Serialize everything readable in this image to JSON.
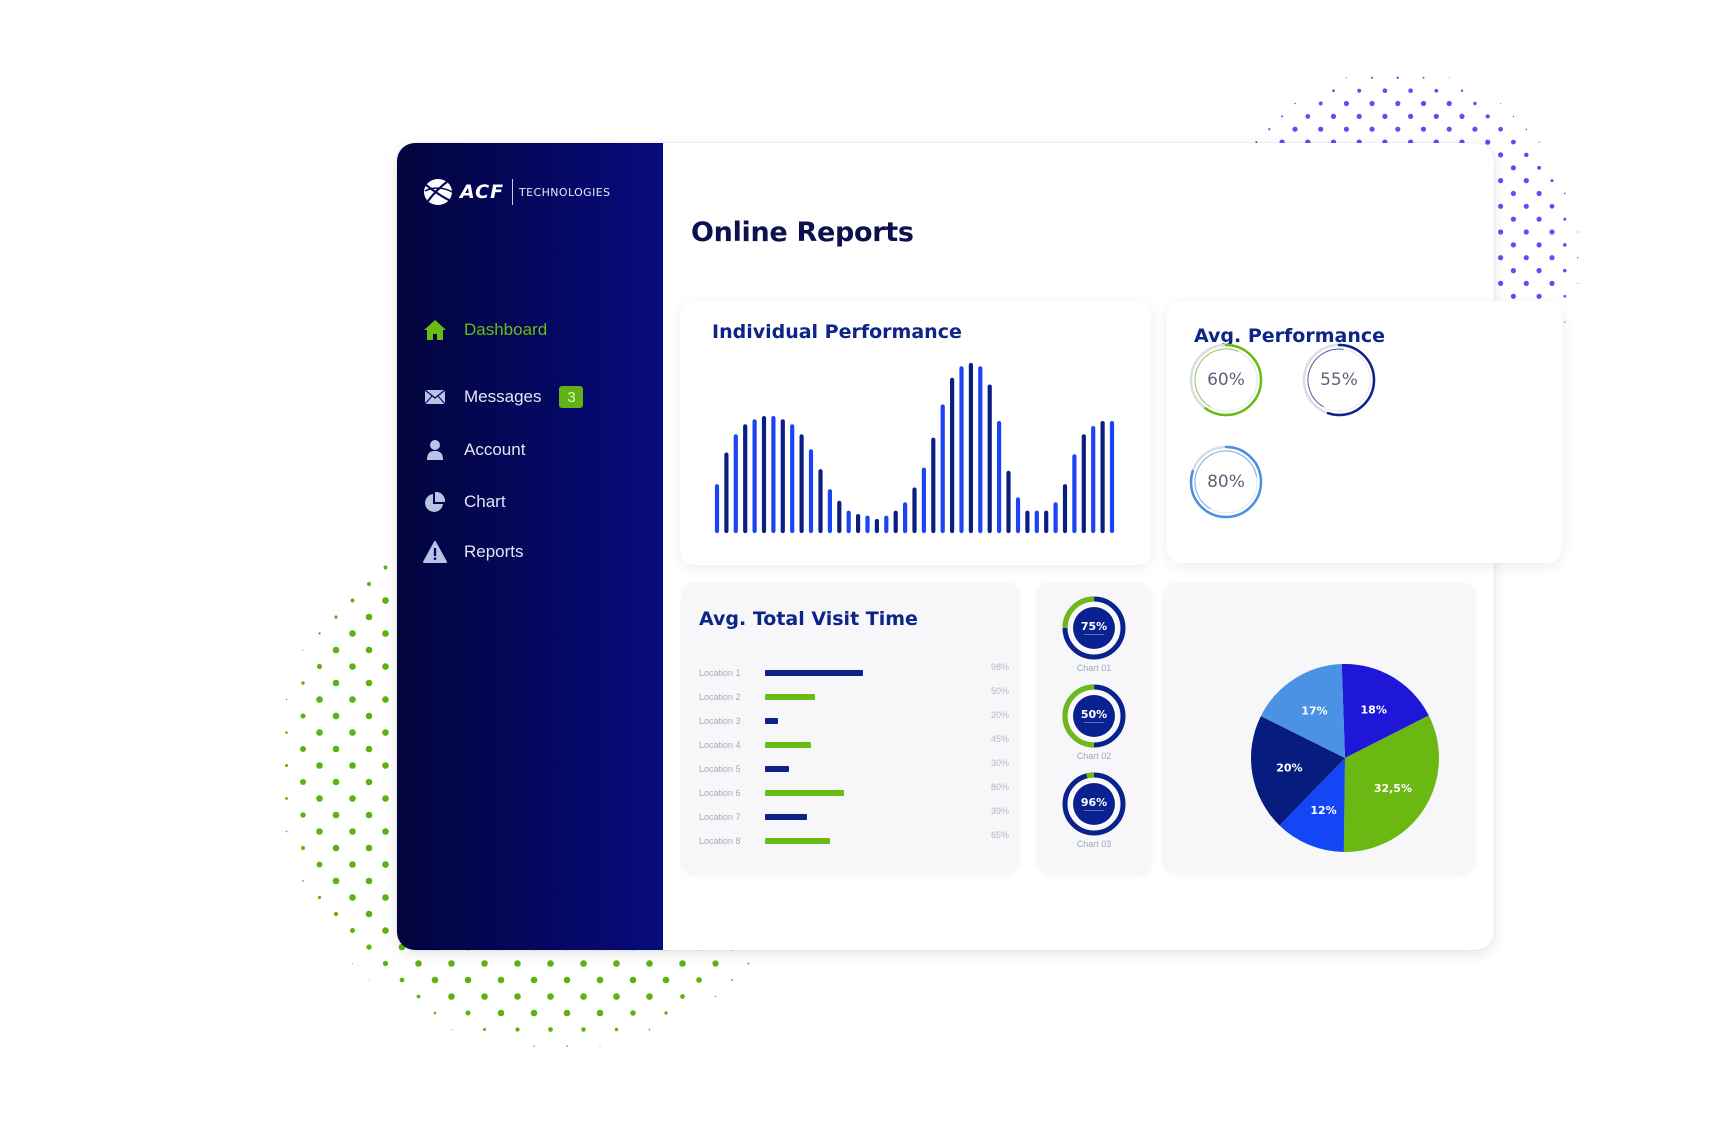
{
  "brand": {
    "name": "ACF",
    "suffix": "TECHNOLOGIES",
    "colors": {
      "navy": "#040760",
      "green": "#6cbb14",
      "blue": "#1a44f5",
      "dark_blue": "#0b1f80",
      "dots_blue": "#5a4ff5",
      "dots_green": "#5cb30e"
    }
  },
  "sidebar": {
    "items": [
      {
        "label": "Dashboard",
        "icon": "home-icon",
        "active": true
      },
      {
        "label": "Messages",
        "icon": "envelope-icon",
        "badge": "3"
      },
      {
        "label": "Account",
        "icon": "user-icon"
      },
      {
        "label": "Chart",
        "icon": "pie-chart-icon"
      },
      {
        "label": "Reports",
        "icon": "warning-icon"
      }
    ]
  },
  "page": {
    "title": "Online Reports"
  },
  "individual_performance": {
    "title": "Individual Performance"
  },
  "avg_performance": {
    "title": "Avg. Performance",
    "rings": [
      {
        "label": "60%",
        "value": 0.6,
        "color": "#6cbb14"
      },
      {
        "label": "55%",
        "value": 0.55,
        "color": "#0d2488"
      },
      {
        "label": "80%",
        "value": 0.8,
        "color": "#4a90e2"
      }
    ]
  },
  "visit_time": {
    "title": "Avg. Total Visit Time",
    "rows": [
      {
        "label": "Location 1",
        "value": "98%",
        "bar": 0.98,
        "color": "#0b2389"
      },
      {
        "label": "Location 2",
        "value": "50%",
        "bar": 0.5,
        "color": "#6cbb14"
      },
      {
        "label": "Location 3",
        "value": "20%",
        "bar": 0.13,
        "color": "#0b2389"
      },
      {
        "label": "Location 4",
        "value": "45%",
        "bar": 0.46,
        "color": "#6cbb14"
      },
      {
        "label": "Location 5",
        "value": "30%",
        "bar": 0.24,
        "color": "#0b2389"
      },
      {
        "label": "Location 6",
        "value": "80%",
        "bar": 0.79,
        "color": "#6cbb14"
      },
      {
        "label": "Location 7",
        "value": "39%",
        "bar": 0.42,
        "color": "#0b2389"
      },
      {
        "label": "Location 8",
        "value": "65%",
        "bar": 0.65,
        "color": "#6cbb14"
      }
    ]
  },
  "donuts": [
    {
      "value_label": "75%",
      "value": 0.75,
      "caption": "Chart 01"
    },
    {
      "value_label": "50%",
      "value": 0.5,
      "caption": "Chart 02"
    },
    {
      "value_label": "96%",
      "value": 0.96,
      "caption": "Chart 03"
    }
  ],
  "chart_data": [
    {
      "type": "bar",
      "title": "Individual Performance",
      "xlabel": "",
      "ylabel": "",
      "ylim": [
        0,
        100
      ],
      "grid": false,
      "values": [
        27,
        46,
        57,
        63,
        66,
        68,
        68,
        66,
        63,
        57,
        48,
        36,
        24,
        17,
        11,
        9,
        8,
        6,
        8,
        11,
        16,
        25,
        37,
        55,
        75,
        91,
        98,
        100,
        98,
        87,
        65,
        35,
        19,
        11,
        11,
        11,
        16,
        27,
        45,
        57,
        62,
        65,
        65
      ],
      "colors": [
        "#1a44f5",
        "#0b1f80"
      ]
    },
    {
      "type": "pie",
      "title": "",
      "slices": [
        {
          "label": "18%",
          "value": 18,
          "color": "#1f17d8"
        },
        {
          "label": "32,5%",
          "value": 32.5,
          "color": "#6cb812"
        },
        {
          "label": "12%",
          "value": 12,
          "color": "#1546f5"
        },
        {
          "label": "20%",
          "value": 20,
          "color": "#061d7f"
        },
        {
          "label": "17%",
          "value": 17,
          "color": "#4b91e4"
        }
      ]
    }
  ]
}
